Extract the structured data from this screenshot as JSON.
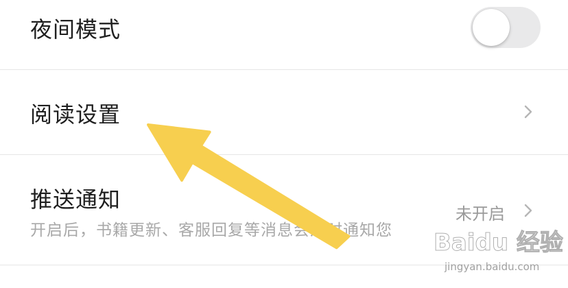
{
  "settings": {
    "night_mode": {
      "label": "夜间模式",
      "enabled": false
    },
    "reading": {
      "label": "阅读设置"
    },
    "push": {
      "label": "推送通知",
      "description": "开启后，书籍更新、客服回复等消息会及时通知您",
      "status": "未开启"
    }
  },
  "watermark": {
    "brand": "Baidu 经验",
    "site": "jingyan.baidu.com"
  },
  "colors": {
    "annotation_arrow": "#f7cf4f",
    "toggle_off": "#e9e9ea",
    "divider": "#e6e6e6",
    "subtext": "#a8a8a8"
  },
  "icons": {
    "chevron": "chevron-right-icon",
    "annotation": "arrow-icon"
  }
}
